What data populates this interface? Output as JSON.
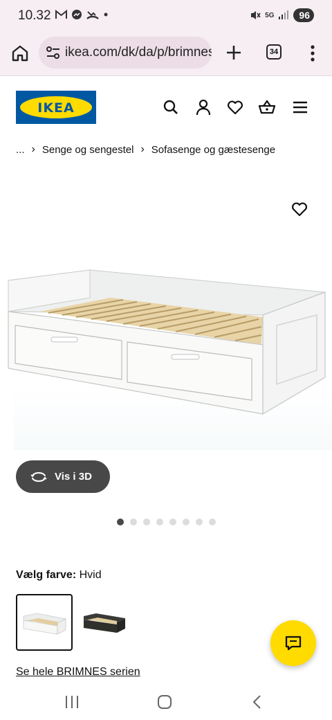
{
  "status_bar": {
    "time": "10.32",
    "network": "5G",
    "battery": "96",
    "notification_icons": [
      "gmail-icon",
      "messenger-icon",
      "missed-call-icon",
      "dot-icon"
    ]
  },
  "browser": {
    "url": "ikea.com/dk/da/p/brimnes",
    "tab_count": "34"
  },
  "header": {
    "logo_text": "IKEA",
    "brand_colors": {
      "blue": "#0058a3",
      "yellow": "#ffdb00"
    }
  },
  "breadcrumb": {
    "ellipsis": "...",
    "items": [
      "Senge og sengestel",
      "Sofasenge og gæstesenge"
    ]
  },
  "product": {
    "view_3d_label": "Vis i 3D",
    "image_count": 8,
    "active_image_index": 0
  },
  "color": {
    "label": "Vælg farve:",
    "selected_value": "Hvid"
  },
  "series_link": "Se hele BRIMNES serien"
}
